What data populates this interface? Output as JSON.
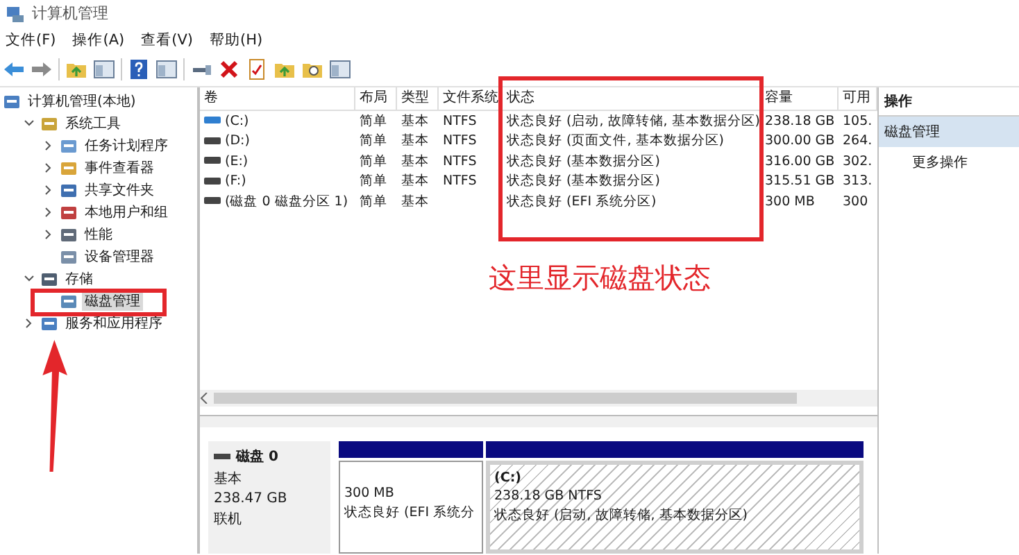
{
  "window": {
    "title": "计算机管理"
  },
  "menu": [
    "文件(F)",
    "操作(A)",
    "查看(V)",
    "帮助(H)"
  ],
  "tree": [
    {
      "label": "计算机管理(本地)",
      "selected": false,
      "children": [
        {
          "label": "系统工具",
          "selected": false,
          "expanded": true,
          "children": [
            {
              "label": "任务计划程序",
              "selected": false,
              "expanded": false
            },
            {
              "label": "事件查看器",
              "selected": false,
              "expanded": false
            },
            {
              "label": "共享文件夹",
              "selected": false,
              "expanded": false
            },
            {
              "label": "本地用户和组",
              "selected": false,
              "expanded": false
            },
            {
              "label": "性能",
              "selected": false,
              "expanded": false
            },
            {
              "label": "设备管理器",
              "selected": false
            }
          ]
        },
        {
          "label": "存储",
          "selected": false,
          "expanded": true,
          "children": [
            {
              "label": "磁盘管理",
              "selected": true
            }
          ]
        },
        {
          "label": "服务和应用程序",
          "selected": false,
          "expanded": false
        }
      ]
    }
  ],
  "table": {
    "columns": [
      "卷",
      "布局",
      "类型",
      "文件系统",
      "状态",
      "容量",
      "可用"
    ],
    "rows": [
      {
        "kind": "system",
        "cells": [
          "(C:)",
          "简单",
          "基本",
          "NTFS",
          "状态良好 (启动, 故障转储, 基本数据分区)",
          "238.18 GB",
          "105."
        ]
      },
      {
        "kind": "data",
        "cells": [
          "(D:)",
          "简单",
          "基本",
          "NTFS",
          "状态良好 (页面文件, 基本数据分区)",
          "300.00 GB",
          "264."
        ]
      },
      {
        "kind": "data",
        "cells": [
          "(E:)",
          "简单",
          "基本",
          "NTFS",
          "状态良好 (基本数据分区)",
          "316.00 GB",
          "302."
        ]
      },
      {
        "kind": "data",
        "cells": [
          "(F:)",
          "简单",
          "基本",
          "NTFS",
          "状态良好 (基本数据分区)",
          "315.51 GB",
          "313."
        ]
      },
      {
        "kind": "data",
        "cells": [
          "(磁盘 0 磁盘分区 1)",
          "简单",
          "基本",
          "",
          "状态良好 (EFI 系统分区)",
          "300 MB",
          "300"
        ]
      }
    ]
  },
  "disk": {
    "name": "磁盘 0",
    "type": "基本",
    "size": "238.47 GB",
    "status": "联机",
    "partitions": [
      {
        "selected": false,
        "size": "300 MB",
        "status": "状态良好 (EFI 系统分"
      },
      {
        "selected": true,
        "name": "(C:)",
        "size": "238.18 GB NTFS",
        "status": "状态良好 (启动, 故障转储, 基本数据分区)"
      }
    ]
  },
  "actions": {
    "title": "操作",
    "items": [
      {
        "label": "磁盘管理",
        "selected": true
      },
      {
        "label": "更多操作",
        "selected": false
      }
    ]
  },
  "annotation": {
    "text": "这里显示磁盘状态"
  }
}
